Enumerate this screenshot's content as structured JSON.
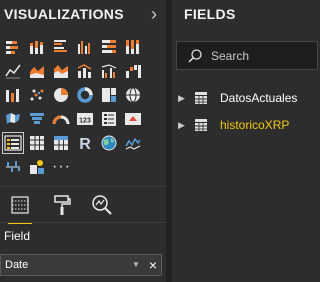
{
  "visualizations": {
    "title": "VISUALIZATIONS",
    "collapse_glyph": "›",
    "icons": [
      "stacked-bar-chart-icon",
      "stacked-column-chart-icon",
      "clustered-bar-chart-icon",
      "clustered-column-chart-icon",
      "100-stacked-bar-chart-icon",
      "100-stacked-column-chart-icon",
      "line-chart-icon",
      "area-chart-icon",
      "stacked-area-chart-icon",
      "line-and-stacked-column-chart-icon",
      "line-and-clustered-column-chart-icon",
      "waterfall-chart-icon",
      "ribbon-chart-icon",
      "scatter-chart-icon",
      "pie-chart-icon",
      "donut-chart-icon",
      "treemap-icon",
      "map-icon",
      "filled-map-icon",
      "funnel-icon",
      "gauge-icon",
      "card-icon",
      "multi-row-card-icon",
      "kpi-icon",
      "slicer-icon",
      "table-visual-icon",
      "matrix-icon",
      "r-script-visual-icon",
      "globe-map-icon",
      "timeline-icon",
      "waterfall-visual-icon",
      "custom-visual-icon",
      "more-visuals-icon"
    ],
    "more_label": "···",
    "selected_icon": "slicer-icon",
    "tabs": [
      "fields-tab-icon",
      "format-paint-roller-icon",
      "analytics-magnifier-icon"
    ],
    "active_tab": "fields-tab-icon",
    "field_section_label": "Field",
    "field_well_value": "Date",
    "field_dropdown_glyph": "▼",
    "field_remove_glyph": "×"
  },
  "fields": {
    "title": "FIELDS",
    "search_placeholder": "Search",
    "tables": [
      {
        "name": "DatosActuales",
        "highlighted": false
      },
      {
        "name": "historicoXRP",
        "highlighted": true
      }
    ],
    "expand_glyph": "▶"
  },
  "colors": {
    "pane_background": "#2d2d2d",
    "accent_yellow": "#f2c811",
    "highlight_text": "#f2c811",
    "normal_text": "#ffffff",
    "viz_blue": "#5b9bd5",
    "viz_orange": "#ed7d31",
    "viz_white": "#e8e8e8"
  }
}
